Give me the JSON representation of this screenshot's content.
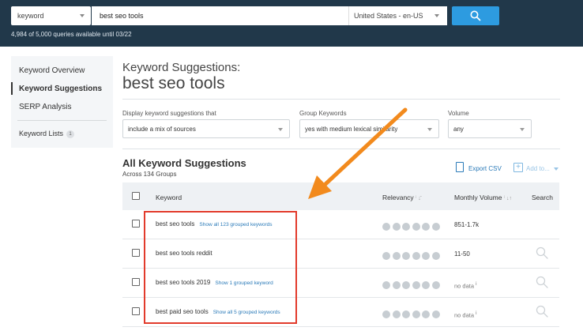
{
  "topbar": {
    "search_type": "keyword",
    "query": "best seo tools",
    "region": "United States - en-US",
    "quota_text": "4,984 of 5,000 queries available until 03/22"
  },
  "sidebar": {
    "items": [
      {
        "label": "Keyword Overview"
      },
      {
        "label": "Keyword Suggestions"
      },
      {
        "label": "SERP Analysis"
      },
      {
        "label": "Keyword Lists",
        "badge": "1"
      }
    ]
  },
  "main": {
    "heading": "Keyword Suggestions:",
    "query_heading": "best seo tools",
    "filters": {
      "display_label": "Display keyword suggestions that",
      "display_value": "include a mix of sources",
      "group_label": "Group Keywords",
      "group_value": "yes with medium lexical similarity",
      "volume_label": "Volume",
      "volume_value": "any"
    },
    "section_title": "All Keyword Suggestions",
    "section_sub": "Across 134 Groups",
    "export_label": "Export CSV",
    "addto_label": "Add to...",
    "columns": {
      "keyword": "Keyword",
      "relevancy": "Relevancy",
      "volume": "Monthly Volume",
      "search": "Search"
    },
    "rows": [
      {
        "keyword": "best seo tools",
        "group_link": "Show all 123 grouped keywords",
        "volume": "851-1.7k"
      },
      {
        "keyword": "best seo tools reddit",
        "group_link": "",
        "volume": "11-50"
      },
      {
        "keyword": "best seo tools 2019",
        "group_link": "Show 1 grouped keyword",
        "volume": "no data"
      },
      {
        "keyword": "best paid seo tools",
        "group_link": "Show all 5 grouped keywords",
        "volume": "no data"
      }
    ]
  },
  "colors": {
    "topbar_bg": "#21384a",
    "search_button": "#2d9be0",
    "link": "#2a7ab8",
    "highlight_box": "#e23b2c",
    "annotation_arrow": "#f28a1d"
  }
}
